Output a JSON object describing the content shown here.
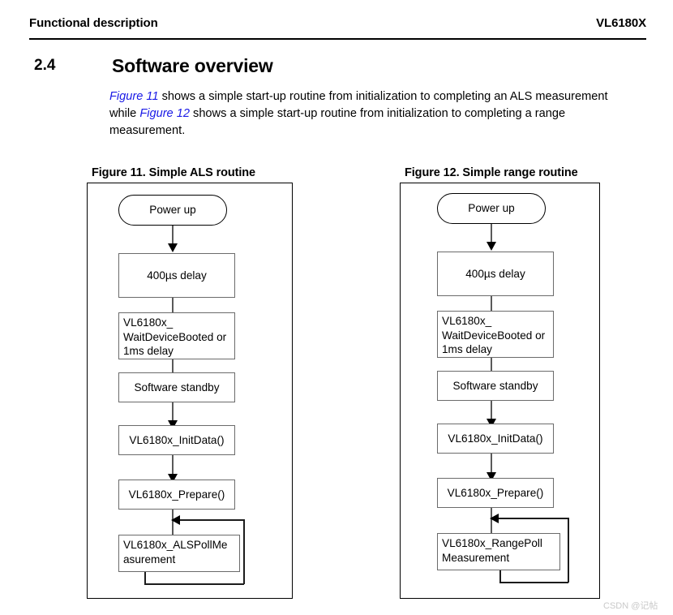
{
  "header": {
    "left_title": "Functional description",
    "right_title": "VL6180X"
  },
  "section": {
    "number": "2.4",
    "title": "Software overview"
  },
  "body": {
    "part1_link": "Figure 11",
    "part2": " shows a simple start-up routine from initialization to completing an ALS measurement while ",
    "part3_link": "Figure 12",
    "part4": " shows a simple start-up routine from initialization to completing a range measurement."
  },
  "figures": [
    {
      "caption": "Figure 11. Simple ALS routine",
      "nodes": {
        "start": "Power up",
        "delay": "400µs delay",
        "wait": "VL6180x_ WaitDeviceBooted or 1ms delay",
        "standby": "Software standby",
        "init": "VL6180x_InitData()",
        "prepare": "VL6180x_Prepare()",
        "poll": "VL6180x_ALSPollMe asurement"
      }
    },
    {
      "caption": "Figure 12. Simple range routine",
      "nodes": {
        "start": "Power up",
        "delay": "400µs delay",
        "wait": "VL6180x_ WaitDeviceBooted or 1ms delay",
        "standby": "Software standby",
        "init": "VL6180x_InitData()",
        "prepare": "VL6180x_Prepare()",
        "poll": "VL6180x_RangePoll Measurement"
      }
    }
  ],
  "watermark": "CSDN @记帖",
  "colors": {
    "link": "#1a1ae6",
    "node_border": "#6b6b6b",
    "frame": "#000000",
    "watermark": "#c9c9c9"
  }
}
